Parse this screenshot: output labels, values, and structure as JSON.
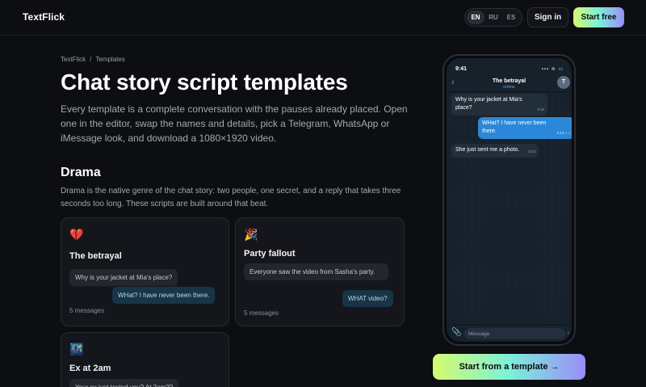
{
  "header": {
    "brand": "TextFlick",
    "languages": [
      "EN",
      "RU",
      "ES"
    ],
    "active_language": "EN",
    "sign_in": "Sign in",
    "start_free": "Start free"
  },
  "breadcrumb": {
    "home": "TextFlick",
    "separator": "/",
    "current": "Templates"
  },
  "hero": {
    "title": "Chat story script templates",
    "lead": "Every template is a complete conversation with the pauses already placed. Open one in the editor, swap the names and details, pick a Telegram, WhatsApp or iMessage look, and download a 1080×1920 video."
  },
  "section": {
    "title": "Drama",
    "description": "Drama is the native genre of the chat story: two people, one secret, and a reply that takes three seconds too long. These scripts are built around that beat."
  },
  "cards": [
    {
      "emoji": "💔",
      "title": "The betrayal",
      "incoming": "Why is your jacket at Mia's place?",
      "outgoing": "WHat? I have never been there.",
      "count": "5 messages"
    },
    {
      "emoji": "🎉",
      "title": "Party fallout",
      "incoming": "Everyone saw the video from Sasha's party.",
      "outgoing": "WHAT video?",
      "count": "5 messages"
    },
    {
      "emoji": "🌃",
      "title": "Ex at 2am",
      "incoming": "Your ex just texted you? At 2am??",
      "outgoing": "",
      "count": ""
    }
  ],
  "phone": {
    "time": "9:41",
    "status_icons": "▪▪▪ ≋ ▭",
    "contact": "The betrayal",
    "status": "online",
    "avatar_letter": "T",
    "back": "‹",
    "messages": [
      {
        "side": "in",
        "text": "Why is your jacket at Mia's place?",
        "time": "3:12"
      },
      {
        "side": "out",
        "text": "WHat? I have never been there.",
        "time": "3:13 ✓✓"
      },
      {
        "side": "in",
        "text": "She just sent me a photo.",
        "time": "3:14"
      }
    ],
    "input_placeholder": "Message",
    "attach_icon": "📎",
    "send_icon": "›"
  },
  "cta": {
    "label": "Start from a template →"
  },
  "colors": {
    "background": "#0d0e12",
    "accent_gradient_start": "#d6fb6e",
    "accent_gradient_mid": "#7cf0d9",
    "accent_gradient_end": "#9a8cf8",
    "outgoing_bubble": "#2b88d8"
  }
}
